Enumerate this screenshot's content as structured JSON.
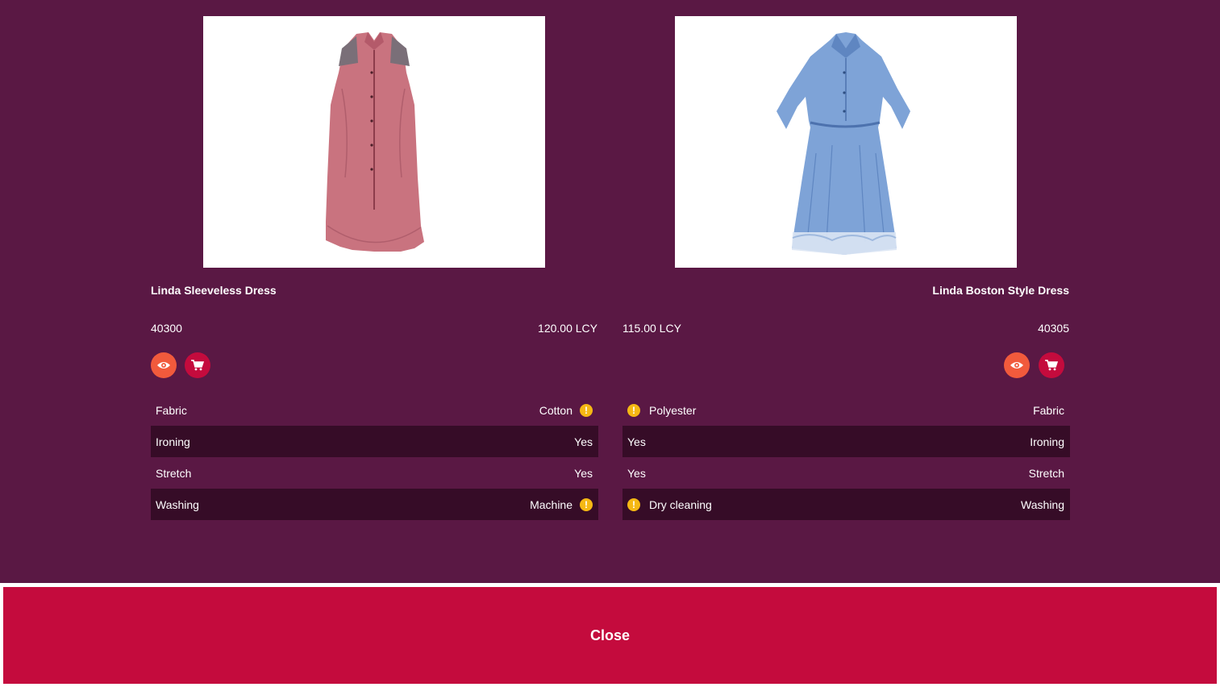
{
  "products": [
    {
      "name": "Linda Sleeveless Dress",
      "number": "40300",
      "price": "120.00 LCY",
      "image_icon": "pink-sleeveless-dress-image",
      "specs": [
        {
          "label": "Fabric",
          "value": "Cotton",
          "warning": true
        },
        {
          "label": "Ironing",
          "value": "Yes",
          "warning": false
        },
        {
          "label": "Stretch",
          "value": "Yes",
          "warning": false
        },
        {
          "label": "Washing",
          "value": "Machine",
          "warning": true
        }
      ]
    },
    {
      "name": "Linda Boston Style Dress",
      "number": "40305",
      "price": "115.00 LCY",
      "image_icon": "blue-shirt-dress-image",
      "specs": [
        {
          "label": "Fabric",
          "value": "Polyester",
          "warning": true
        },
        {
          "label": "Ironing",
          "value": "Yes",
          "warning": false
        },
        {
          "label": "Stretch",
          "value": "Yes",
          "warning": false
        },
        {
          "label": "Washing",
          "value": "Dry cleaning",
          "warning": true
        }
      ]
    }
  ],
  "icons": {
    "view": "eye-icon",
    "cart": "cart-icon",
    "warning": "exclamation-icon",
    "warning_glyph": "!"
  },
  "colors": {
    "background": "#5a1844",
    "row_dark": "#360c27",
    "view_button": "#f15a3c",
    "cart_button": "#c40b3d",
    "warning": "#f5b814",
    "close_button": "#c40b3d"
  },
  "close": {
    "label": "Close"
  }
}
